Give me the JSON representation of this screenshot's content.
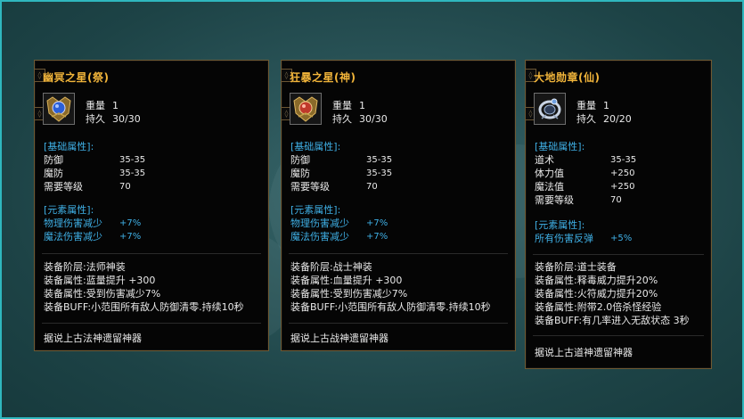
{
  "tooltips": [
    {
      "title": "幽冥之星(祭)",
      "weight_label": "重量",
      "weight": "1",
      "durability_label": "持久",
      "durability": "30/30",
      "base_header": "[基础属性]:",
      "base_attrs": [
        {
          "label": "防御",
          "value": "35-35"
        },
        {
          "label": "魔防",
          "value": "35-35"
        },
        {
          "label": "需要等级",
          "value": "70"
        }
      ],
      "elem_header": "[元素属性]:",
      "elem_attrs": [
        {
          "label": "物理伤害减少",
          "value": "+7%"
        },
        {
          "label": "魔法伤害减少",
          "value": "+7%"
        }
      ],
      "extra_lines": [
        "装备阶层:法师神装",
        "装备属性:蓝量提升 +300",
        "装备属性:受到伤害减少7%",
        "装备BUFF:小范围所有敌人防御清零.持续10秒"
      ],
      "lore": "据说上古法神遗留神器",
      "icon": "blue-orb-medal-icon",
      "gem_color": "#2a5fd8"
    },
    {
      "title": "狂暴之星(神)",
      "weight_label": "重量",
      "weight": "1",
      "durability_label": "持久",
      "durability": "30/30",
      "base_header": "[基础属性]:",
      "base_attrs": [
        {
          "label": "防御",
          "value": "35-35"
        },
        {
          "label": "魔防",
          "value": "35-35"
        },
        {
          "label": "需要等级",
          "value": "70"
        }
      ],
      "elem_header": "[元素属性]:",
      "elem_attrs": [
        {
          "label": "物理伤害减少",
          "value": "+7%"
        },
        {
          "label": "魔法伤害减少",
          "value": "+7%"
        }
      ],
      "extra_lines": [
        "装备阶层:战士神装",
        "装备属性:血量提升 +300",
        "装备属性:受到伤害减少7%",
        "装备BUFF:小范围所有敌人防御清零.持续10秒"
      ],
      "lore": "据说上古战神遗留神器",
      "icon": "red-orb-medal-icon",
      "gem_color": "#c0392b"
    },
    {
      "title": "大地勋章(仙)",
      "weight_label": "重量",
      "weight": "1",
      "durability_label": "持久",
      "durability": "20/20",
      "base_header": "[基础属性]:",
      "base_attrs": [
        {
          "label": "道术",
          "value": "35-35"
        },
        {
          "label": "体力值",
          "value": "+250"
        },
        {
          "label": "魔法值",
          "value": "+250"
        },
        {
          "label": "需要等级",
          "value": "70"
        }
      ],
      "elem_header": "[元素属性]:",
      "elem_attrs": [
        {
          "label": "所有伤害反弹",
          "value": "+5%"
        }
      ],
      "extra_lines": [
        "装备阶层:道士装备",
        "装备属性:释毒威力提升20%",
        "装备属性:火符威力提升20%",
        "装备属性:附带2.0倍杀怪经验",
        "装备BUFF:有几率进入无敌状态 3秒"
      ],
      "lore": "据说上古道神遗留神器",
      "icon": "silver-ring-medal-icon",
      "gem_color": "#9fb6d6"
    }
  ]
}
